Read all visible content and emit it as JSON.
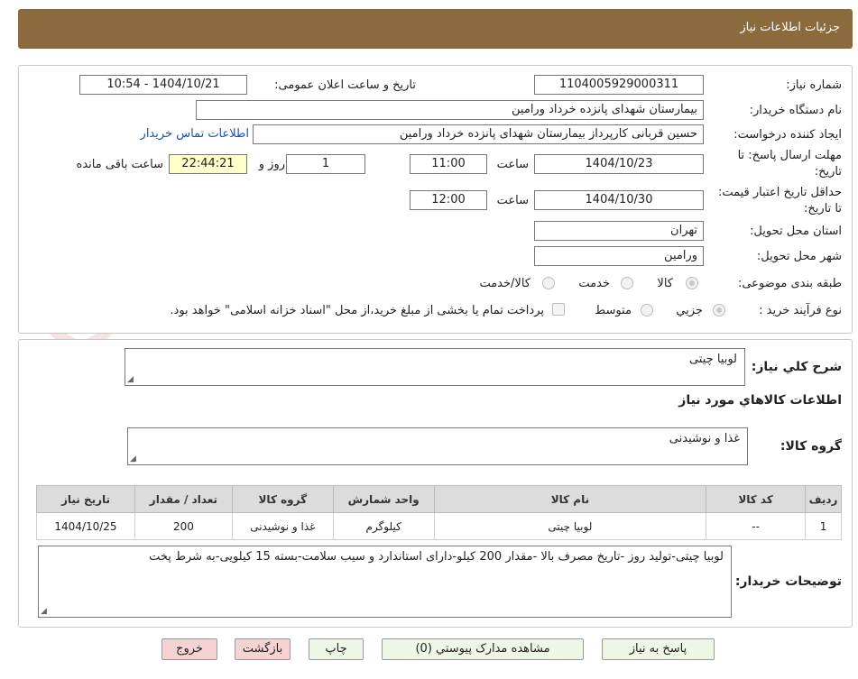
{
  "header": {
    "title": "جزئیات اطلاعات نیاز"
  },
  "labels": {
    "need_number": "شماره نیاز:",
    "announce_datetime": "تاریخ و ساعت اعلان عمومی:",
    "buyer_org": "نام دستگاه خریدار:",
    "requester": "ایجاد کننده درخواست:",
    "reply_deadline": "مهلت ارسال پاسخ: تا تاریخ:",
    "time": "ساعت",
    "day_and": "روز و",
    "remaining": "ساعت باقی مانده",
    "price_validity": "حداقل تاریخ اعتبار قیمت: تا تاریخ:",
    "delivery_province": "استان محل تحویل:",
    "delivery_city": "شهر محل تحویل:",
    "category": "طبقه بندی موضوعی:",
    "process_type": "نوع فرآیند خرید :",
    "general_desc": "شرح کلي نياز:",
    "items_info": "اطلاعات کالاهاي مورد نياز",
    "goods_group": "گروه کالا:",
    "buyer_notes": "توضیحات خریدار:"
  },
  "values": {
    "need_number": "1104005929000311",
    "announce_datetime": "1404/10/21 - 10:54",
    "buyer_org": "بیمارستان شهدای پانزده خرداد ورامین",
    "requester": "حسین قربانی کارپرداز بیمارستان شهدای پانزده خرداد ورامین",
    "contact_link": "اطلاعات تماس خریدار",
    "reply_date": "1404/10/23",
    "reply_time": "11:00",
    "reply_days": "1",
    "remaining_time": "22:44:21",
    "validity_date": "1404/10/30",
    "validity_time": "12:00",
    "province": "تهران",
    "city": "ورامین",
    "general_desc": "لوبیا چیتی",
    "goods_group": "غذا و نوشیدنی",
    "buyer_notes": "لوبیا چیتی-تولید روز -تاریخ مصرف بالا -مقدار 200 کیلو-دارای استاندارد و سیب سلامت-بسته 15 کیلویی-به شرط پخت"
  },
  "category_options": [
    {
      "label": "کالا",
      "selected": true
    },
    {
      "label": "خدمت",
      "selected": false
    },
    {
      "label": "کالا/خدمت",
      "selected": false
    }
  ],
  "process_options": [
    {
      "label": "جزیي",
      "selected": true
    },
    {
      "label": "متوسط",
      "selected": false
    }
  ],
  "treasury_note": "پرداخت تمام یا بخشی از مبلغ خرید،از محل \"اسناد خزانه اسلامی\" خواهد بود.",
  "table": {
    "headers": [
      "ردیف",
      "کد کالا",
      "نام کالا",
      "واحد شمارش",
      "گروه کالا",
      "تعداد / مقدار",
      "تاریخ نیاز"
    ],
    "rows": [
      [
        "1",
        "--",
        "لوبیا چیتی",
        "کیلوگرم",
        "غذا و نوشیدنی",
        "200",
        "1404/10/25"
      ]
    ]
  },
  "buttons": {
    "reply": "پاسخ به نیاز",
    "attachments": "مشاهده مدارک پیوستي (0)",
    "print": "چاپ",
    "back": "بازگشت",
    "exit": "خروج"
  },
  "watermark": {
    "text": "AriaTender.neT"
  },
  "colors": {
    "header_bg": "#8b6b3d",
    "button_bg": "#eef7e6",
    "button_red_bg": "#f6d3d3",
    "highlight": "#ffffcc",
    "link": "#1a4fb8"
  }
}
